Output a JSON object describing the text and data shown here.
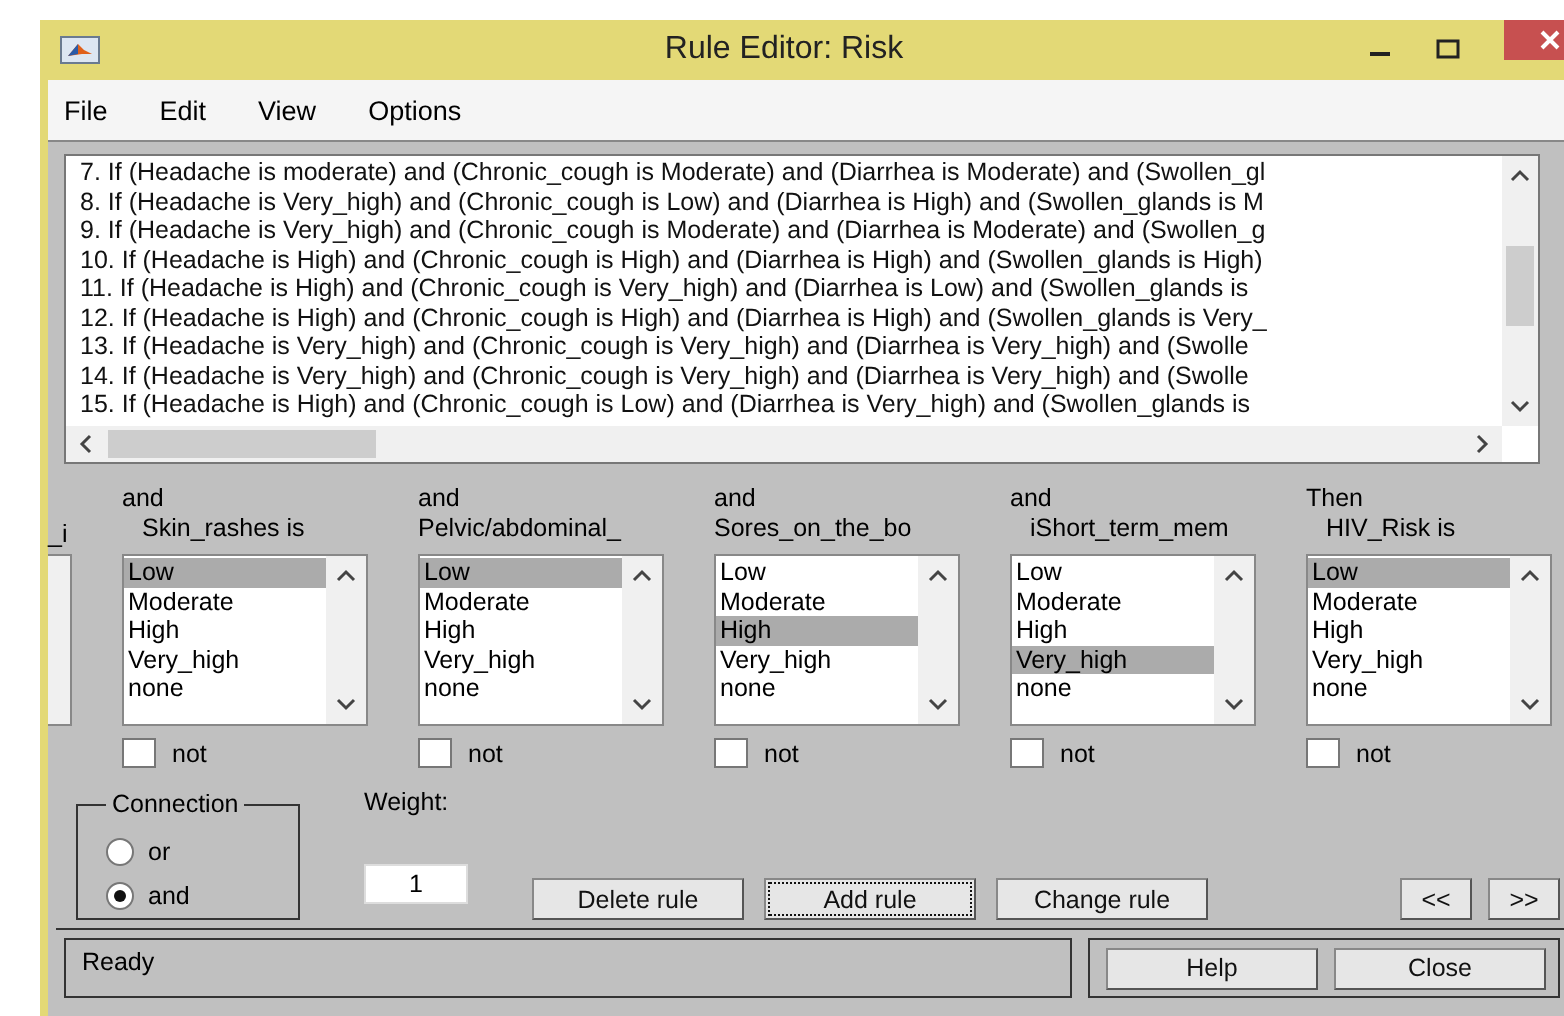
{
  "window": {
    "title": "Rule Editor: Risk"
  },
  "menu": [
    "File",
    "Edit",
    "View",
    "Options"
  ],
  "rules": [
    "7. If (Headache is moderate) and (Chronic_cough is Moderate) and (Diarrhea is Moderate) and (Swollen_gl",
    "8. If (Headache is Very_high) and (Chronic_cough is Low) and (Diarrhea is High) and (Swollen_glands is M",
    "9. If (Headache is Very_high) and (Chronic_cough is Moderate) and (Diarrhea is Moderate) and (Swollen_g",
    "10. If (Headache is High) and (Chronic_cough is High) and (Diarrhea is High) and (Swollen_glands is High)",
    "11. If (Headache is High) and (Chronic_cough is Very_high) and (Diarrhea is Low) and (Swollen_glands is",
    "12. If (Headache is High) and (Chronic_cough is High) and (Diarrhea is High) and (Swollen_glands is Very_",
    "13. If (Headache is Very_high) and (Chronic_cough is Very_high) and (Diarrhea is Very_high) and (Swolle",
    "14. If (Headache is Very_high) and (Chronic_cough is Very_high) and (Diarrhea is Very_high) and (Swolle",
    "15. If (Headache is High) and (Chronic_cough is Low) and (Diarrhea is Very_high) and (Swollen_glands is"
  ],
  "partial_column": {
    "label": "_i"
  },
  "columns": [
    {
      "connector": "and",
      "variable": "Skin_rashes is",
      "not": false,
      "options": [
        {
          "label": "Low",
          "selected": true
        },
        {
          "label": "Moderate",
          "selected": false
        },
        {
          "label": "High",
          "selected": false
        },
        {
          "label": "Very_high",
          "selected": false
        },
        {
          "label": "none",
          "selected": false
        }
      ]
    },
    {
      "connector": "and",
      "variable": "Pelvic/abdominal_",
      "not": false,
      "options": [
        {
          "label": "Low",
          "selected": true
        },
        {
          "label": "Moderate",
          "selected": false
        },
        {
          "label": "High",
          "selected": false
        },
        {
          "label": "Very_high",
          "selected": false
        },
        {
          "label": "none",
          "selected": false
        }
      ]
    },
    {
      "connector": "and",
      "variable": "Sores_on_the_bo",
      "not": false,
      "options": [
        {
          "label": "Low",
          "selected": false
        },
        {
          "label": "Moderate",
          "selected": false
        },
        {
          "label": "High",
          "selected": true
        },
        {
          "label": "Very_high",
          "selected": false
        },
        {
          "label": "none",
          "selected": false
        }
      ]
    },
    {
      "connector": "and",
      "variable": "iShort_term_mem",
      "not": false,
      "options": [
        {
          "label": "Low",
          "selected": false
        },
        {
          "label": "Moderate",
          "selected": false
        },
        {
          "label": "High",
          "selected": false
        },
        {
          "label": "Very_high",
          "selected": true
        },
        {
          "label": "none",
          "selected": false
        }
      ]
    },
    {
      "connector": "Then",
      "variable": "HIV_Risk is",
      "not": false,
      "options": [
        {
          "label": "Low",
          "selected": true
        },
        {
          "label": "Moderate",
          "selected": false
        },
        {
          "label": "High",
          "selected": false
        },
        {
          "label": "Very_high",
          "selected": false
        },
        {
          "label": "none",
          "selected": false
        }
      ]
    }
  ],
  "not_labels": [
    "not",
    "not",
    "not",
    "not",
    "not"
  ],
  "connection": {
    "title": "Connection",
    "options": [
      {
        "label": "or",
        "selected": false
      },
      {
        "label": "and",
        "selected": true
      }
    ]
  },
  "weight": {
    "label": "Weight:",
    "value": "1"
  },
  "rule_buttons": [
    {
      "label": "Delete rule",
      "focused": false
    },
    {
      "label": "Add rule",
      "focused": true
    },
    {
      "label": "Change rule",
      "focused": false
    }
  ],
  "nav_buttons": [
    "<<",
    ">>"
  ],
  "status": "Ready",
  "footer_buttons": [
    "Help",
    "Close"
  ]
}
